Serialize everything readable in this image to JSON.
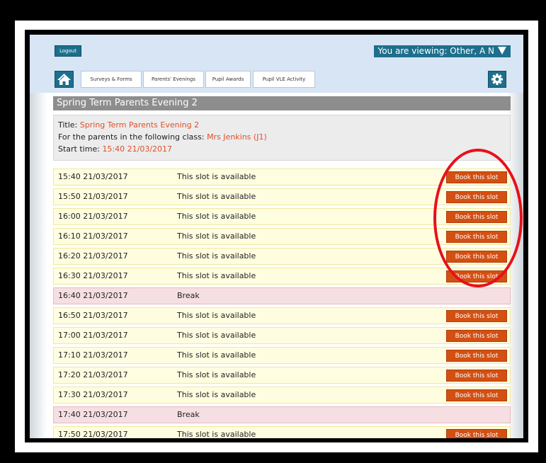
{
  "topbar": {
    "logout_label": "Logout",
    "viewing_label": "You are viewing: Other, A N"
  },
  "tabs": [
    {
      "label": "Surveys & Forms"
    },
    {
      "label": "Parents' Evenings"
    },
    {
      "label": "Pupil Awards"
    },
    {
      "label": "Pupil VLE Activity"
    }
  ],
  "section_title": "Spring Term Parents Evening 2",
  "info": {
    "title_label": "Title:",
    "title_value": "Spring Term Parents Evening 2",
    "class_label": "For the parents in the following class:",
    "class_value": "Mrs Jenkins (J1)",
    "start_label": "Start time:",
    "start_value": "15:40 21/03/2017"
  },
  "book_label": "Book this slot",
  "slots": [
    {
      "time": "15:40 21/03/2017",
      "status": "This slot is available",
      "book": "Book this slot"
    },
    {
      "time": "15:50 21/03/2017",
      "status": "This slot is available",
      "book": "Book this slot"
    },
    {
      "time": "16:00 21/03/2017",
      "status": "This slot is available",
      "book": "Book this slot"
    },
    {
      "time": "16:10 21/03/2017",
      "status": "This slot is available",
      "book": "Book this slot"
    },
    {
      "time": "16:20 21/03/2017",
      "status": "This slot is available",
      "book": "Book this slot"
    },
    {
      "time": "16:30 21/03/2017",
      "status": "This slot is available",
      "book": "Book this slot"
    },
    {
      "time": "16:40 21/03/2017",
      "status": "Break",
      "book": ""
    },
    {
      "time": "16:50 21/03/2017",
      "status": "This slot is available",
      "book": "Book this slot"
    },
    {
      "time": "17:00 21/03/2017",
      "status": "This slot is available",
      "book": "Book this slot"
    },
    {
      "time": "17:10 21/03/2017",
      "status": "This slot is available",
      "book": "Book this slot"
    },
    {
      "time": "17:20 21/03/2017",
      "status": "This slot is available",
      "book": "Book this slot"
    },
    {
      "time": "17:30 21/03/2017",
      "status": "This slot is available",
      "book": "Book this slot"
    },
    {
      "time": "17:40 21/03/2017",
      "status": "Break",
      "book": ""
    },
    {
      "time": "17:50 21/03/2017",
      "status": "This slot is available",
      "book": "Book this slot"
    }
  ],
  "colors": {
    "accent": "#1d6f8c",
    "book_button": "#d44f12",
    "highlight_value": "#e0502a",
    "available_row": "#fffde0",
    "break_row": "#f6dfe3",
    "annotation_circle": "#e8101b"
  },
  "icons": {
    "home": "home-icon",
    "settings": "gear-icon",
    "dropdown": "chevron-down-icon"
  }
}
